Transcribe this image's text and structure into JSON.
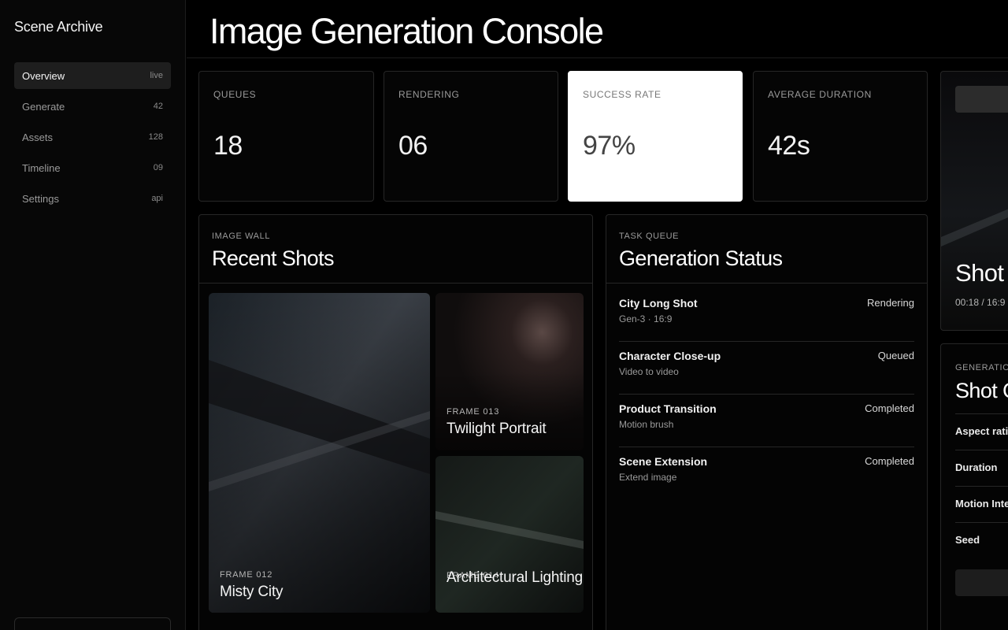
{
  "sidebar": {
    "brand": "Scene Archive",
    "items": [
      {
        "label": "Overview",
        "badge": "live"
      },
      {
        "label": "Generate",
        "badge": "42"
      },
      {
        "label": "Assets",
        "badge": "128"
      },
      {
        "label": "Timeline",
        "badge": "09"
      },
      {
        "label": "Settings",
        "badge": "api"
      }
    ]
  },
  "header": {
    "title": "Image Generation Console"
  },
  "stats": [
    {
      "label": "QUEUES",
      "value": "18"
    },
    {
      "label": "RENDERING",
      "value": "06"
    },
    {
      "label": "SUCCESS RATE",
      "value": "97%"
    },
    {
      "label": "AVERAGE DURATION",
      "value": "42s"
    }
  ],
  "image_wall": {
    "eyebrow": "IMAGE WALL",
    "title": "Recent Shots",
    "tiles": [
      {
        "frame": "FRAME 012",
        "name": "Misty City"
      },
      {
        "frame": "FRAME 013",
        "name": "Twilight Portrait"
      },
      {
        "frame": "FRAME 014",
        "name": "Architectural Lighting"
      }
    ]
  },
  "task_queue": {
    "eyebrow": "TASK QUEUE",
    "title": "Generation Status",
    "tasks": [
      {
        "name": "City Long Shot",
        "sub": "Gen-3 · 16:9",
        "status": "Rendering"
      },
      {
        "name": "Character Close-up",
        "sub": "Video to video",
        "status": "Queued"
      },
      {
        "name": "Product Transition",
        "sub": "Motion brush",
        "status": "Completed"
      },
      {
        "name": "Scene Extension",
        "sub": "Extend image",
        "status": "Completed"
      }
    ]
  },
  "preview": {
    "title": "Shot",
    "meta": "00:18 / 16:9"
  },
  "settings_panel": {
    "eyebrow": "GENERATION",
    "title": "Shot C",
    "rows": [
      "Aspect ratio",
      "Duration",
      "Motion Inte",
      "Seed"
    ]
  },
  "colors": {
    "background": "#000000",
    "highlight_card": "#ffffff",
    "border": "#262626"
  }
}
